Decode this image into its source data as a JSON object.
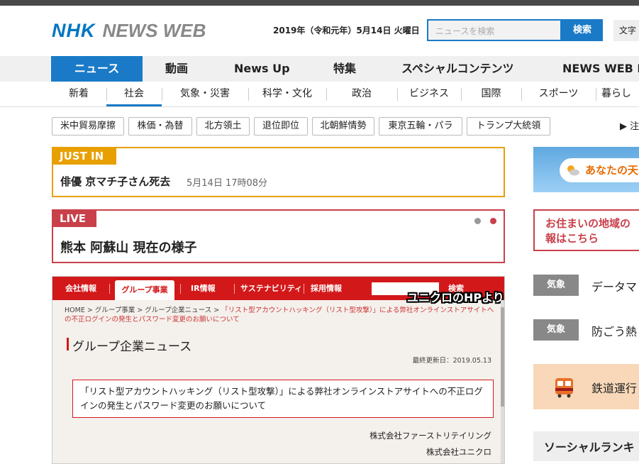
{
  "header": {
    "logo_nhk": "NHK",
    "logo_newsweb": "NEWS WEB",
    "date": "2019年（令和元年）5月14日 火曜日",
    "search_placeholder": "ニュースを検索",
    "search_button": "検索",
    "font_size_label": "文字"
  },
  "main_nav": [
    "ニュース",
    "動画",
    "News Up",
    "特集",
    "スペシャルコンテンツ",
    "NEWS WEB E"
  ],
  "sub_nav": [
    "新着",
    "社会",
    "気象・災害",
    "科学・文化",
    "政治",
    "ビジネス",
    "国際",
    "スポーツ",
    "暮らし"
  ],
  "tags": [
    "米中貿易摩擦",
    "株価・為替",
    "北方領土",
    "退位即位",
    "北朝鮮情勢",
    "東京五輪・パラ",
    "トランプ大統領"
  ],
  "tags_more": "▶ 注",
  "just_in": {
    "label": "JUST IN",
    "headline": "俳優 京マチ子さん死去",
    "time": "5月14日 17時08分"
  },
  "live": {
    "label": "LIVE",
    "headline": "熊本 阿蘇山 現在の様子"
  },
  "screenshot": {
    "nav": [
      "会社情報",
      "グループ事業",
      "IR情報",
      "サステナビリティ",
      "採用情報"
    ],
    "search_btn": "検索",
    "caption": "ユニクロのHPより",
    "breadcrumb_plain": "HOME > グループ事業 > グループ企業ニュース > ",
    "breadcrumb_red": "「リスト型アカウントハッキング（リスト型攻撃）」による弊社オンラインストアサイトへの不正ログインの発生とパスワード変更のお願いについて",
    "section_title": "グループ企業ニュース",
    "updated": "最終更新日：2019.05.13",
    "notice": "「リスト型アカウントハッキング（リスト型攻撃）」による弊社オンラインストアサイトへの不正ログインの発生とパスワード変更のお願いについて",
    "company1": "株式会社ファーストリテイリング",
    "company2": "株式会社ユニクロ"
  },
  "sidebar": {
    "weather": "あなたの天",
    "area": "お住まいの地域の\n報はこちら",
    "area_line1": "お住まいの地域の",
    "area_line2": "報はこちら",
    "wx_items": [
      {
        "badge": "気象",
        "text": "データマ"
      },
      {
        "badge": "気象",
        "text": "防ごう熱"
      }
    ],
    "rail": "鉄道運行",
    "social": "ソーシャルランキ"
  },
  "colors": {
    "brand_blue": "#1a7ac7",
    "justin_orange": "#e8a000",
    "live_red": "#c9404a",
    "uniqlo_red": "#d3181a"
  }
}
